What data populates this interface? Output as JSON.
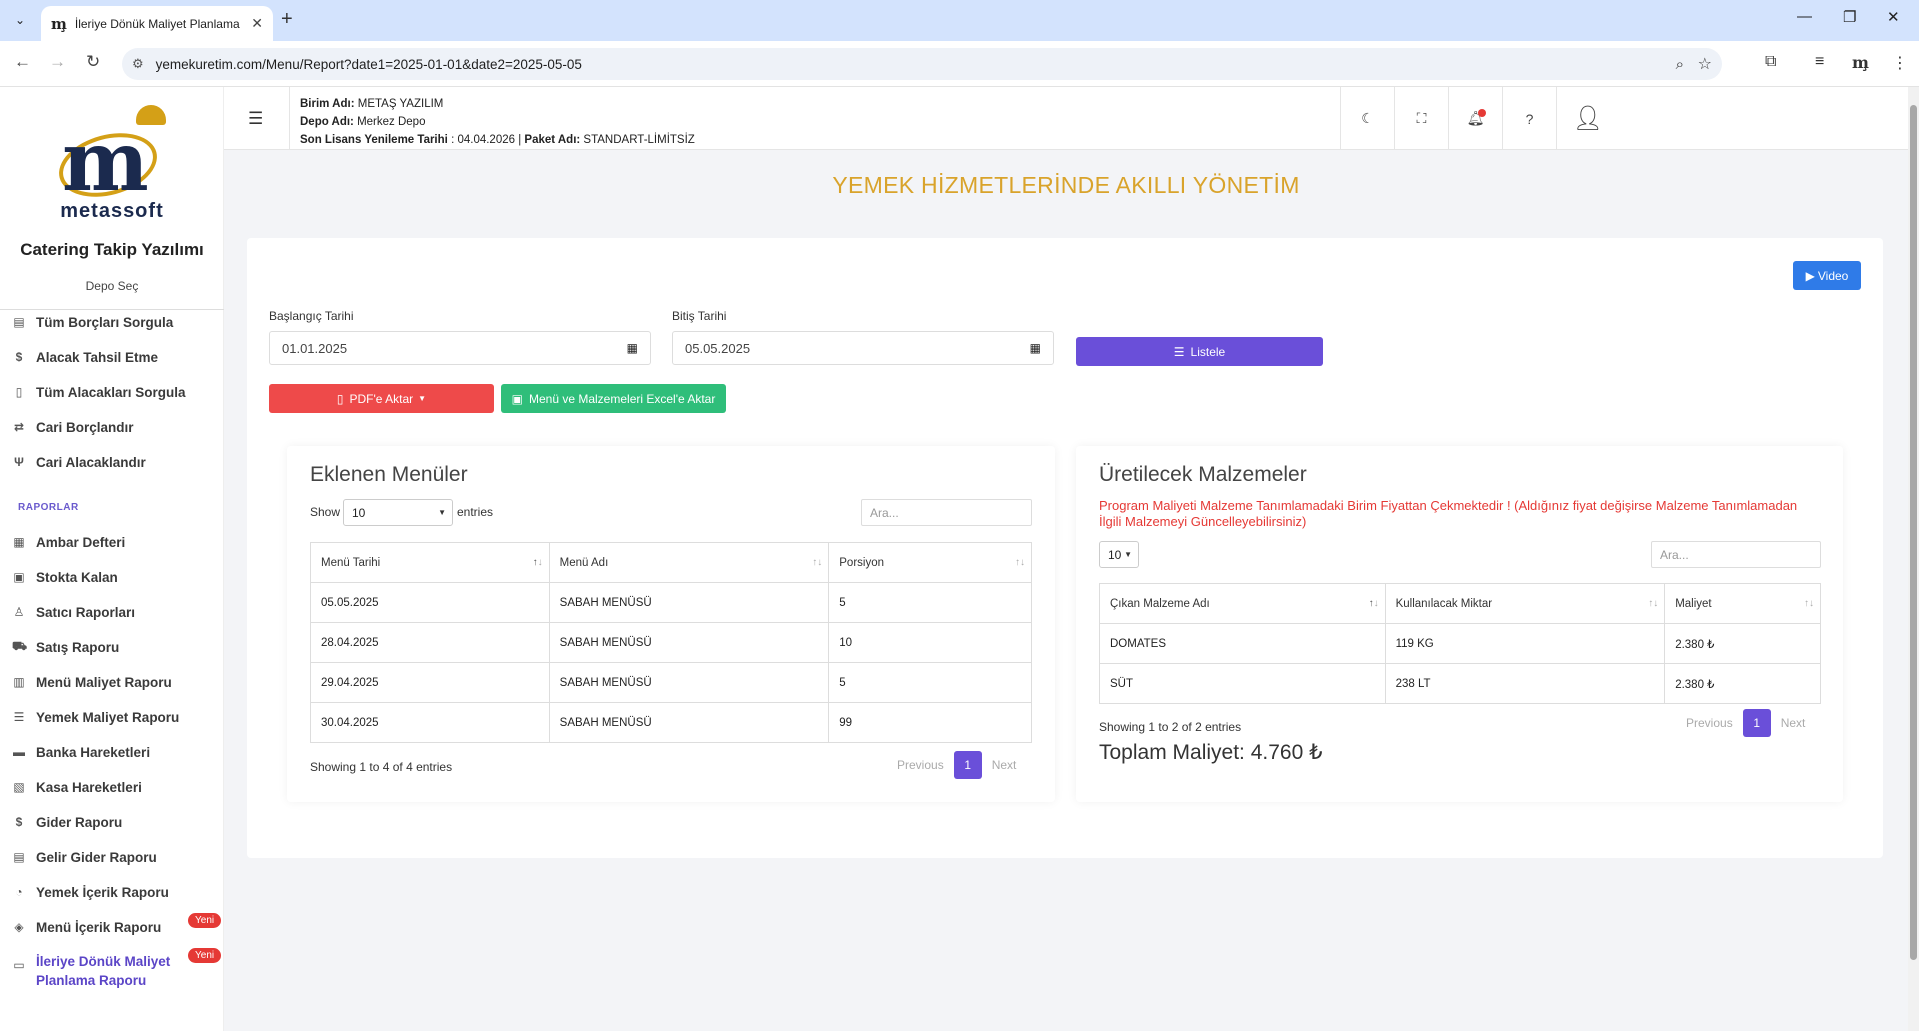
{
  "browser": {
    "tab_title": "İleriye Dönük Maliyet Planlama",
    "tab_favicon": "m̧",
    "url": "yemekuretim.com/Menu/Report?date1=2025-01-01&date2=2025-05-05",
    "toolbar_profile_glyph": "m̧"
  },
  "sidebar": {
    "logo_text": "metassoft",
    "app_title": "Catering Takip Yazılımı",
    "depo_sec": "Depo Seç",
    "items_top": [
      {
        "label": "Tüm Borçları Sorgula",
        "icon": "document-list-icon"
      },
      {
        "label": "Alacak Tahsil Etme",
        "icon": "money-hand-icon"
      },
      {
        "label": "Tüm Alacakları Sorgula",
        "icon": "receipt-icon"
      },
      {
        "label": "Cari Borçlandır",
        "icon": "money-transfer-icon"
      },
      {
        "label": "Cari Alacaklandır",
        "icon": "fork-icon"
      }
    ],
    "section_label": "RAPORLAR",
    "items_reports": [
      {
        "label": "Ambar Defteri",
        "icon": "book-icon"
      },
      {
        "label": "Stokta Kalan",
        "icon": "calculator-icon"
      },
      {
        "label": "Satıcı Raporları",
        "icon": "user-report-icon"
      },
      {
        "label": "Satış Raporu",
        "icon": "cart-icon"
      },
      {
        "label": "Menü Maliyet Raporu",
        "icon": "table-icon"
      },
      {
        "label": "Yemek Maliyet Raporu",
        "icon": "list-icon"
      },
      {
        "label": "Banka Hareketleri",
        "icon": "bank-icon"
      },
      {
        "label": "Kasa Hareketleri",
        "icon": "cash-register-icon"
      },
      {
        "label": "Gider Raporu",
        "icon": "expense-icon"
      },
      {
        "label": "Gelir Gider Raporu",
        "icon": "report-icon"
      },
      {
        "label": "Yemek İçerik Raporu",
        "icon": "chart-icon"
      },
      {
        "label": "Menü İçerik Raporu",
        "icon": "tag-icon",
        "badge": "Yeni"
      }
    ],
    "active_item": {
      "label_line1": "İleriye Dönük Maliyet",
      "label_line2": "Planlama Raporu",
      "badge": "Yeni",
      "icon": "monitor-icon"
    }
  },
  "header": {
    "birim_label": "Birim Adı:",
    "birim_value": "METAŞ YAZILIM",
    "depo_label": "Depo Adı:",
    "depo_value": "Merkez Depo",
    "lisans_label": "Son Lisans Yenileme Tarihi",
    "lisans_value": ": 04.04.2026 |",
    "paket_label": "Paket Adı:",
    "paket_value": "STANDART-LİMİTSİZ"
  },
  "main": {
    "title": "YEMEK HİZMETLERİNDE AKILLI YÖNETİM",
    "video_label": "Video",
    "start_label": "Başlangıç Tarihi",
    "start_value": "01.01.2025",
    "end_label": "Bitiş Tarihi",
    "end_value": "05.05.2025",
    "listele_label": "Listele",
    "pdf_label": "PDF'e Aktar",
    "excel_label": "Menü ve Malzemeleri Excel'e Aktar"
  },
  "menus_panel": {
    "title": "Eklenen Menüler",
    "show_label": "Show",
    "entries_label": "entries",
    "page_size": "10",
    "search_placeholder": "Ara...",
    "columns": [
      "Menü Tarihi",
      "Menü Adı",
      "Porsiyon"
    ],
    "rows": [
      [
        "05.05.2025",
        "SABAH MENÜSÜ",
        "5"
      ],
      [
        "28.04.2025",
        "SABAH MENÜSÜ",
        "10"
      ],
      [
        "29.04.2025",
        "SABAH MENÜSÜ",
        "5"
      ],
      [
        "30.04.2025",
        "SABAH MENÜSÜ",
        "99"
      ]
    ],
    "info": "Showing 1 to 4 of 4 entries",
    "prev": "Previous",
    "page": "1",
    "next": "Next"
  },
  "materials_panel": {
    "title": "Üretilecek Malzemeler",
    "warning": "Program Maliyeti Malzeme Tanımlamadaki Birim Fiyattan Çekmektedir ! (Aldığınız fiyat değişirse Malzeme Tanımlamadan İlgili Malzemeyi Güncelleyebilirsiniz)",
    "page_size": "10",
    "search_placeholder": "Ara...",
    "columns": [
      "Çıkan Malzeme Adı",
      "Kullanılacak Miktar",
      "Maliyet"
    ],
    "rows": [
      [
        "DOMATES",
        "119 KG",
        "2.380 ₺"
      ],
      [
        "SÜT",
        "238 LT",
        "2.380 ₺"
      ]
    ],
    "info": "Showing 1 to 2 of 2 entries",
    "prev": "Previous",
    "page": "1",
    "next": "Next",
    "total": "Toplam Maliyet: 4.760 ₺"
  }
}
